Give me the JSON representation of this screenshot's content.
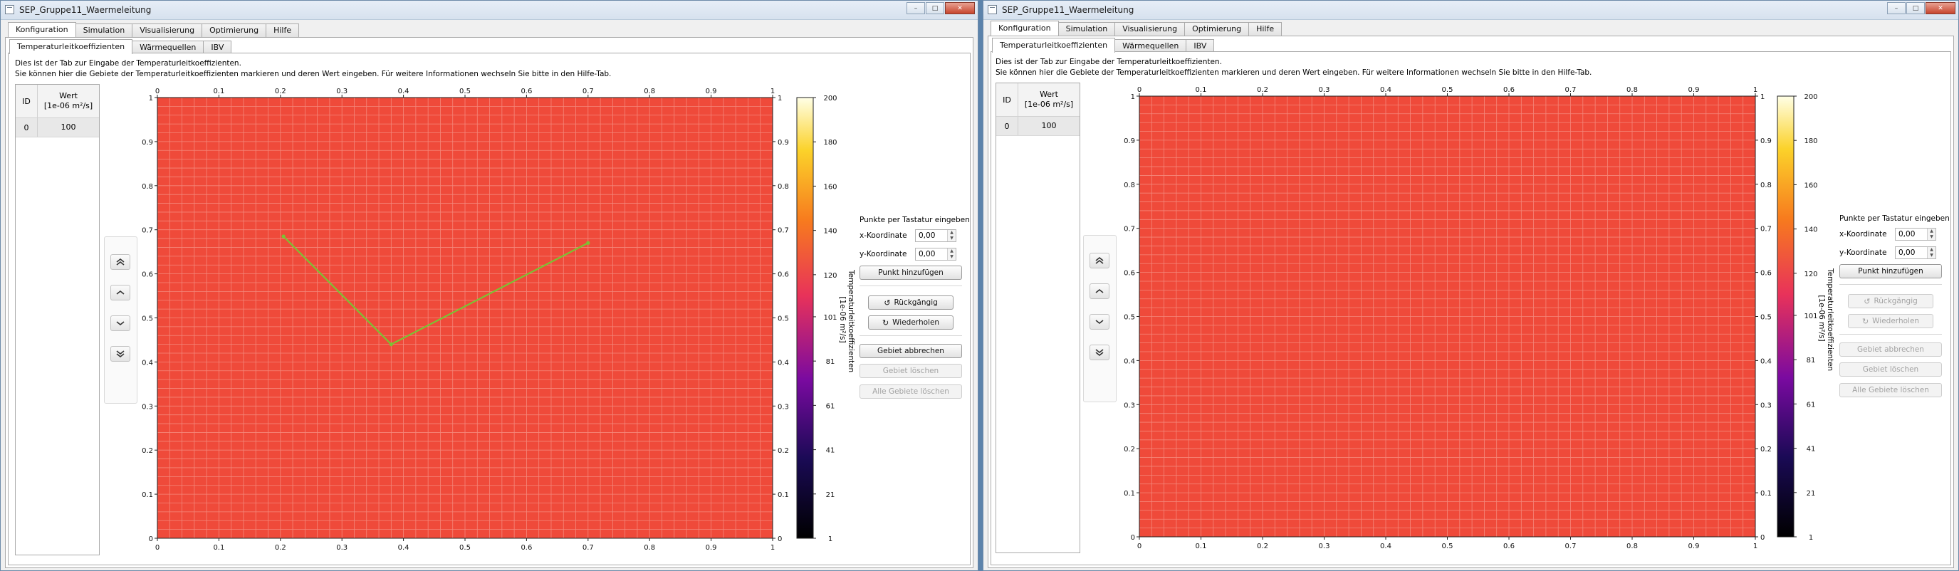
{
  "windows": [
    {
      "title": "SEP_Gruppe11_Waermeleitung",
      "main_tabs": [
        "Konfiguration",
        "Simulation",
        "Visualisierung",
        "Optimierung",
        "Hilfe"
      ],
      "sub_tabs": [
        "Temperaturleitkoeffizienten",
        "Wärmequellen",
        "IBV"
      ],
      "description": [
        "Dies ist der Tab zur Eingabe der Temperaturleitkoeffizienten.",
        "Sie können hier die Gebiete der Temperaturleitkoeffizienten markieren und deren Wert eingeben. Für weitere Informationen wechseln Sie bitte in den Hilfe-Tab."
      ],
      "table": {
        "col_id": "ID",
        "col_value_1": "Wert",
        "col_value_2": "[1e-06 m²/s]",
        "rows": [
          {
            "id": "0",
            "value": "100"
          }
        ]
      },
      "side_panel": {
        "title": "Punkte per Tastatur eingeben",
        "x_label": "x-Koordinate",
        "x_value": "0,00",
        "y_label": "y-Koordinate",
        "y_value": "0,00",
        "add_point": "Punkt hinzufügen",
        "undo": "Rückgängig",
        "redo": "Wiederholen",
        "cancel_area": "Gebiet abbrechen",
        "delete_area": "Gebiet löschen",
        "delete_all": "Alle Gebiete löschen"
      },
      "colorbar": {
        "label_1": "Temperaturleitkoeffizienten",
        "label_2": "[1e-06 m²/s]"
      }
    },
    {
      "title": "SEP_Gruppe11_Waermeleitung",
      "main_tabs": [
        "Konfiguration",
        "Simulation",
        "Visualisierung",
        "Optimierung",
        "Hilfe"
      ],
      "sub_tabs": [
        "Temperaturleitkoeffizienten",
        "Wärmequellen",
        "IBV"
      ],
      "description": [
        "Dies ist der Tab zur Eingabe der Temperaturleitkoeffizienten.",
        "Sie können hier die Gebiete der Temperaturleitkoeffizienten markieren und deren Wert eingeben. Für weitere Informationen wechseln Sie bitte in den Hilfe-Tab."
      ],
      "table": {
        "col_id": "ID",
        "col_value_1": "Wert",
        "col_value_2": "[1e-06 m²/s]",
        "rows": [
          {
            "id": "0",
            "value": "100"
          }
        ]
      },
      "side_panel": {
        "title": "Punkte per Tastatur eingeben",
        "x_label": "x-Koordinate",
        "x_value": "0,00",
        "y_label": "y-Koordinate",
        "y_value": "0,00",
        "add_point": "Punkt hinzufügen",
        "undo": "Rückgängig",
        "redo": "Wiederholen",
        "cancel_area": "Gebiet abbrechen",
        "delete_area": "Gebiet löschen",
        "delete_all": "Alle Gebiete löschen"
      },
      "colorbar": {
        "label_1": "Temperaturleitkoeffizienten",
        "label_2": "[1e-06 m²/s]"
      }
    }
  ],
  "chart_data": [
    {
      "type": "heatmap",
      "x_ticks": [
        "0",
        "0.1",
        "0.2",
        "0.3",
        "0.4",
        "0.5",
        "0.6",
        "0.7",
        "0.8",
        "0.9",
        "1"
      ],
      "y_ticks": [
        "0",
        "0.1",
        "0.2",
        "0.3",
        "0.4",
        "0.5",
        "0.6",
        "0.7",
        "0.8",
        "0.9",
        "1"
      ],
      "xlim": [
        0,
        1
      ],
      "ylim": [
        0,
        1
      ],
      "grid": true,
      "field_value": 100,
      "field_color": "#ef4a3a",
      "colorbar_ticks": [
        "1",
        "21",
        "41",
        "61",
        "81",
        "101",
        "120",
        "140",
        "160",
        "180",
        "200"
      ],
      "colorbar_range": [
        1,
        200
      ],
      "polyline": {
        "color": "#7cc233",
        "points": [
          [
            0.205,
            0.685
          ],
          [
            0.38,
            0.44
          ],
          [
            0.7,
            0.67
          ]
        ]
      }
    },
    {
      "type": "heatmap",
      "x_ticks": [
        "0",
        "0.1",
        "0.2",
        "0.3",
        "0.4",
        "0.5",
        "0.6",
        "0.7",
        "0.8",
        "0.9",
        "1"
      ],
      "y_ticks": [
        "0",
        "0.1",
        "0.2",
        "0.3",
        "0.4",
        "0.5",
        "0.6",
        "0.7",
        "0.8",
        "0.9",
        "1"
      ],
      "xlim": [
        0,
        1
      ],
      "ylim": [
        0,
        1
      ],
      "grid": true,
      "field_value": 100,
      "field_color": "#ef4a3a",
      "colorbar_ticks": [
        "1",
        "21",
        "41",
        "61",
        "81",
        "101",
        "120",
        "140",
        "160",
        "180",
        "200"
      ],
      "colorbar_range": [
        1,
        200
      ],
      "polyline": null
    }
  ]
}
